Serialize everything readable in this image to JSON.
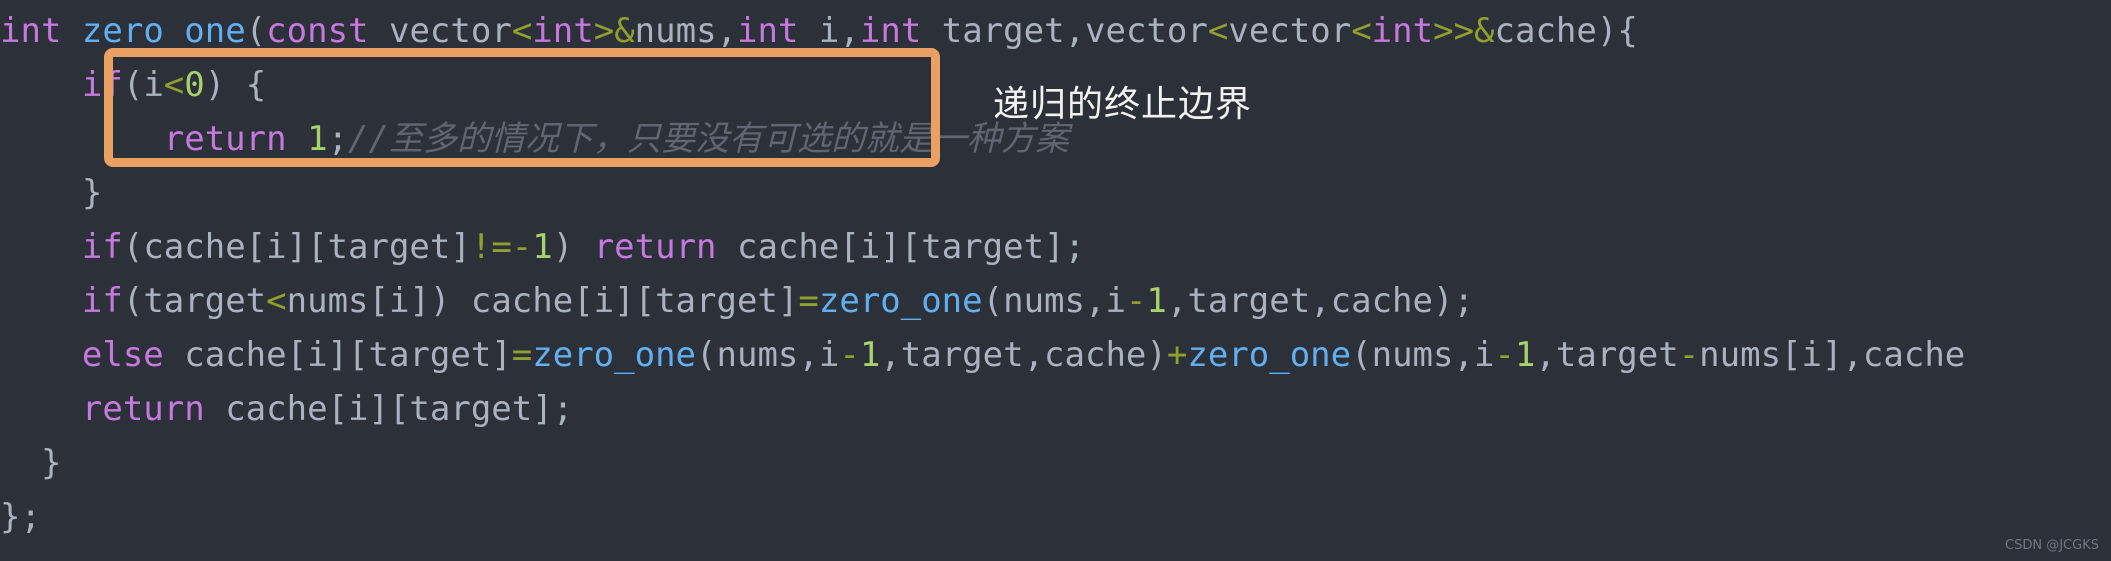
{
  "editor": {
    "background_color": "#2b3039",
    "font_size_px": 34,
    "theme_name": "one-dark"
  },
  "colors": {
    "keyword": "#c678dd",
    "function": "#61afef",
    "identifier": "#abb2bf",
    "operator": "#8fa02d",
    "number": "#a9d16b",
    "comment": "#5f6672",
    "highlight_border": "#eaa062",
    "annotation_text": "#f2f2f2",
    "watermark": "#6f7683"
  },
  "code": {
    "language": "cpp",
    "lines": [
      {
        "index": 0,
        "indent": "",
        "text": "int zero_one(const vector<int>&nums,int i,int target,vector<vector<int>>&cache){",
        "tokens": [
          {
            "t": "int",
            "c": "kw"
          },
          {
            "t": " ",
            "c": "id"
          },
          {
            "t": "zero_one",
            "c": "fn"
          },
          {
            "t": "(",
            "c": "id"
          },
          {
            "t": "const",
            "c": "kw"
          },
          {
            "t": " vector",
            "c": "id"
          },
          {
            "t": "<",
            "c": "op"
          },
          {
            "t": "int",
            "c": "kw"
          },
          {
            "t": ">&",
            "c": "op"
          },
          {
            "t": "nums,",
            "c": "id"
          },
          {
            "t": "int",
            "c": "kw"
          },
          {
            "t": " i,",
            "c": "id"
          },
          {
            "t": "int",
            "c": "kw"
          },
          {
            "t": " target,vector",
            "c": "id"
          },
          {
            "t": "<",
            "c": "op"
          },
          {
            "t": "vector",
            "c": "id"
          },
          {
            "t": "<",
            "c": "op"
          },
          {
            "t": "int",
            "c": "kw"
          },
          {
            "t": ">>&",
            "c": "op"
          },
          {
            "t": "cache){",
            "c": "id"
          }
        ]
      },
      {
        "index": 1,
        "indent": "    ",
        "text": "    if(i<0) {",
        "tokens": [
          {
            "t": "    ",
            "c": "id"
          },
          {
            "t": "if",
            "c": "kw"
          },
          {
            "t": "(i",
            "c": "id"
          },
          {
            "t": "<",
            "c": "op"
          },
          {
            "t": "0",
            "c": "num"
          },
          {
            "t": ") {",
            "c": "id"
          }
        ]
      },
      {
        "index": 2,
        "indent": "        ",
        "text": "        return 1;//至多的情况下，只要没有可选的就是一种方案",
        "tokens": [
          {
            "t": "        ",
            "c": "id"
          },
          {
            "t": "return",
            "c": "kw"
          },
          {
            "t": " ",
            "c": "id"
          },
          {
            "t": "1",
            "c": "num"
          },
          {
            "t": ";",
            "c": "id"
          },
          {
            "t": "//至多的情况下，只要没有可选的就是一种方案",
            "c": "cmt"
          }
        ]
      },
      {
        "index": 3,
        "indent": "    ",
        "text": "    }",
        "tokens": [
          {
            "t": "    }",
            "c": "id"
          }
        ]
      },
      {
        "index": 4,
        "indent": "    ",
        "text": "    if(cache[i][target]!=-1) return cache[i][target];",
        "tokens": [
          {
            "t": "    ",
            "c": "id"
          },
          {
            "t": "if",
            "c": "kw"
          },
          {
            "t": "(cache[i][target]",
            "c": "id"
          },
          {
            "t": "!=-",
            "c": "op"
          },
          {
            "t": "1",
            "c": "num"
          },
          {
            "t": ") ",
            "c": "id"
          },
          {
            "t": "return",
            "c": "kw"
          },
          {
            "t": " cache[i][target];",
            "c": "id"
          }
        ]
      },
      {
        "index": 5,
        "indent": "    ",
        "text": "    if(target<nums[i]) cache[i][target]=zero_one(nums,i-1,target,cache);",
        "tokens": [
          {
            "t": "    ",
            "c": "id"
          },
          {
            "t": "if",
            "c": "kw"
          },
          {
            "t": "(target",
            "c": "id"
          },
          {
            "t": "<",
            "c": "op"
          },
          {
            "t": "nums[i]) cache[i][target]",
            "c": "id"
          },
          {
            "t": "=",
            "c": "op"
          },
          {
            "t": "zero_one",
            "c": "fn"
          },
          {
            "t": "(nums,i",
            "c": "id"
          },
          {
            "t": "-",
            "c": "op"
          },
          {
            "t": "1",
            "c": "num"
          },
          {
            "t": ",target,cache);",
            "c": "id"
          }
        ]
      },
      {
        "index": 6,
        "indent": "    ",
        "text": "    else cache[i][target]=zero_one(nums,i-1,target,cache)+zero_one(nums,i-1,target-nums[i],cache",
        "tokens": [
          {
            "t": "    ",
            "c": "id"
          },
          {
            "t": "else",
            "c": "kw"
          },
          {
            "t": " cache[i][target]",
            "c": "id"
          },
          {
            "t": "=",
            "c": "op"
          },
          {
            "t": "zero_one",
            "c": "fn"
          },
          {
            "t": "(nums,i",
            "c": "id"
          },
          {
            "t": "-",
            "c": "op"
          },
          {
            "t": "1",
            "c": "num"
          },
          {
            "t": ",target,cache)",
            "c": "id"
          },
          {
            "t": "+",
            "c": "op"
          },
          {
            "t": "zero_one",
            "c": "fn"
          },
          {
            "t": "(nums,i",
            "c": "id"
          },
          {
            "t": "-",
            "c": "op"
          },
          {
            "t": "1",
            "c": "num"
          },
          {
            "t": ",target",
            "c": "id"
          },
          {
            "t": "-",
            "c": "op"
          },
          {
            "t": "nums[i],cache",
            "c": "id"
          }
        ]
      },
      {
        "index": 7,
        "indent": "    ",
        "text": "    return cache[i][target];",
        "tokens": [
          {
            "t": "    ",
            "c": "id"
          },
          {
            "t": "return",
            "c": "kw"
          },
          {
            "t": " cache[i][target];",
            "c": "id"
          }
        ]
      },
      {
        "index": 8,
        "indent": "  ",
        "text": "  }",
        "tokens": [
          {
            "t": "  }",
            "c": "id"
          }
        ]
      },
      {
        "index": 9,
        "indent": "",
        "text": "};",
        "tokens": [
          {
            "t": "};",
            "c": "id"
          }
        ]
      }
    ]
  },
  "highlight": {
    "label": "recursion-base-case-highlight",
    "border_color": "#eaa062"
  },
  "annotation": {
    "text": "递归的终止边界"
  },
  "watermark": {
    "text": "CSDN @JCGKS"
  }
}
